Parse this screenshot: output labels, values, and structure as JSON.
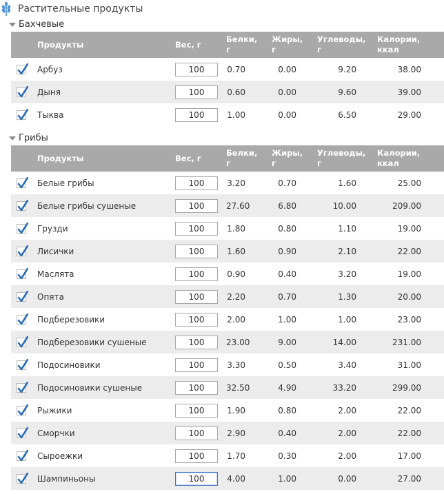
{
  "header": {
    "title": "Растительные продукты",
    "icon": "wheat-icon"
  },
  "columns": {
    "product": "Продукты",
    "weight": "Вес, г",
    "protein": [
      "Белки,",
      "г"
    ],
    "fat": [
      "Жиры,",
      "г"
    ],
    "carbs": [
      "Углеводы,",
      "г"
    ],
    "calories": [
      "Калории,",
      "ккал"
    ]
  },
  "sections": [
    {
      "title": "Бахчевые",
      "rows": [
        {
          "name": "Арбуз",
          "weight": "100",
          "protein": "0.70",
          "fat": "0.00",
          "carbs": "9.20",
          "kcal": "38.00"
        },
        {
          "name": "Дыня",
          "weight": "100",
          "protein": "0.60",
          "fat": "0.00",
          "carbs": "9.60",
          "kcal": "39.00"
        },
        {
          "name": "Тыква",
          "weight": "100",
          "protein": "1.00",
          "fat": "0.00",
          "carbs": "6.50",
          "kcal": "29.00"
        }
      ]
    },
    {
      "title": "Грибы",
      "rows": [
        {
          "name": "Белые грибы",
          "weight": "100",
          "protein": "3.20",
          "fat": "0.70",
          "carbs": "1.60",
          "kcal": "25.00"
        },
        {
          "name": "Белые грибы сушеные",
          "weight": "100",
          "protein": "27.60",
          "fat": "6.80",
          "carbs": "10.00",
          "kcal": "209.00"
        },
        {
          "name": "Грузди",
          "weight": "100",
          "protein": "1.80",
          "fat": "0.80",
          "carbs": "1.10",
          "kcal": "19.00"
        },
        {
          "name": "Лисички",
          "weight": "100",
          "protein": "1.60",
          "fat": "0.90",
          "carbs": "2.10",
          "kcal": "22.00"
        },
        {
          "name": "Маслята",
          "weight": "100",
          "protein": "0.90",
          "fat": "0.40",
          "carbs": "3.20",
          "kcal": "19.00"
        },
        {
          "name": "Опята",
          "weight": "100",
          "protein": "2.20",
          "fat": "0.70",
          "carbs": "1.30",
          "kcal": "20.00"
        },
        {
          "name": "Подберезовики",
          "weight": "100",
          "protein": "2.00",
          "fat": "1.00",
          "carbs": "1.00",
          "kcal": "23.00"
        },
        {
          "name": "Подберезовики сушеные",
          "weight": "100",
          "protein": "23.00",
          "fat": "9.00",
          "carbs": "14.00",
          "kcal": "231.00"
        },
        {
          "name": "Подосиновики",
          "weight": "100",
          "protein": "3.30",
          "fat": "0.50",
          "carbs": "3.40",
          "kcal": "31.00"
        },
        {
          "name": "Подосиновики сушеные",
          "weight": "100",
          "protein": "32.50",
          "fat": "4.90",
          "carbs": "33.20",
          "kcal": "299.00"
        },
        {
          "name": "Рыжики",
          "weight": "100",
          "protein": "1.90",
          "fat": "0.80",
          "carbs": "2.00",
          "kcal": "22.00"
        },
        {
          "name": "Сморчки",
          "weight": "100",
          "protein": "2.90",
          "fat": "0.40",
          "carbs": "2.00",
          "kcal": "22.00"
        },
        {
          "name": "Сыроежки",
          "weight": "100",
          "protein": "1.70",
          "fat": "0.30",
          "carbs": "2.00",
          "kcal": "17.00"
        },
        {
          "name": "Шампиньоны",
          "weight": "100",
          "protein": "4.00",
          "fat": "1.00",
          "carbs": "0.00",
          "kcal": "27.00"
        }
      ]
    }
  ],
  "colors": {
    "header_bg": "#a9a9a9",
    "stripe": "#ececec",
    "check": "#2d6db5",
    "icon": "#4a8fd6"
  }
}
